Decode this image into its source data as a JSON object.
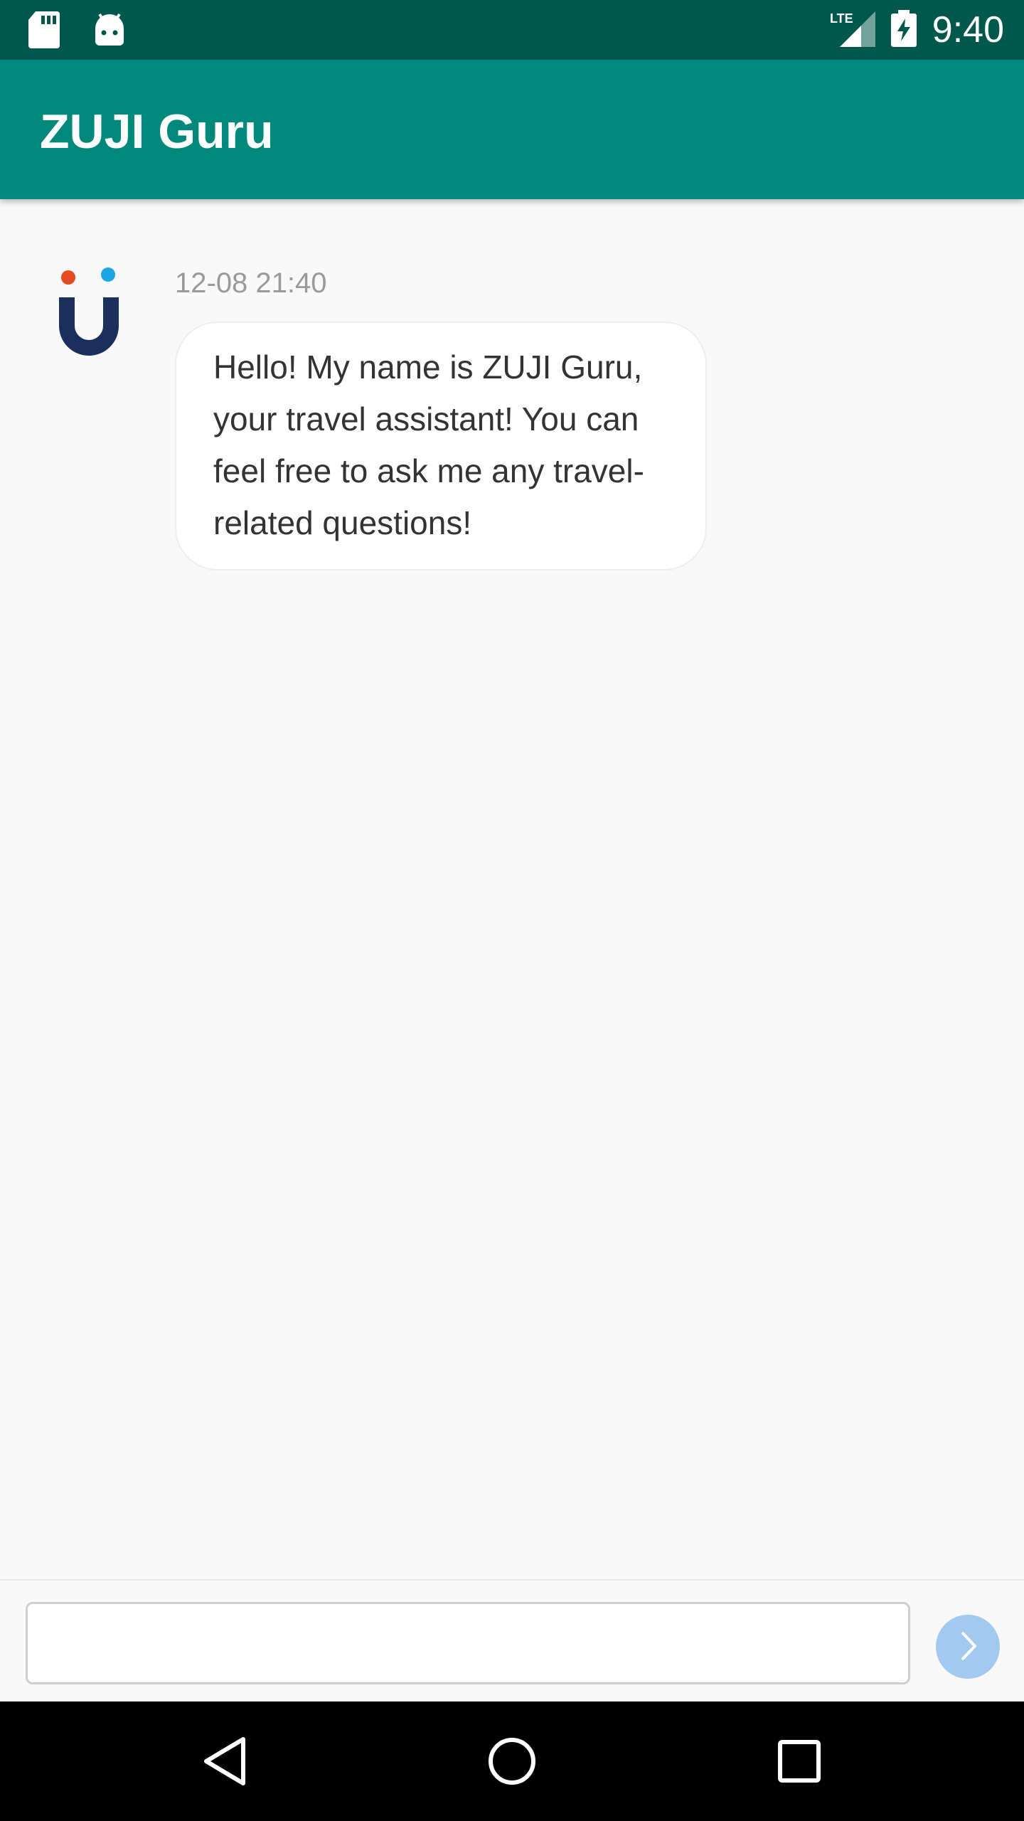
{
  "status_bar": {
    "time": "9:40",
    "network": "LTE",
    "icons": [
      "sd-card-icon",
      "android-icon",
      "signal-icon",
      "battery-charging-icon"
    ]
  },
  "app_bar": {
    "title": "ZUJI Guru",
    "background_color": "#00897b",
    "status_color": "#00574b"
  },
  "messages": [
    {
      "sender": "ZUJI Guru",
      "avatar_icon": "zuji-logo-icon",
      "timestamp": "12-08 21:40",
      "text": "Hello! My name is ZUJI Guru, your travel assistant! You can feel free to ask me any travel-related questions!"
    }
  ],
  "composer": {
    "value": "",
    "placeholder": "",
    "send_icon": "chevron-right-icon",
    "send_color": "#a3c9f1"
  },
  "nav_bar": {
    "buttons": [
      "back-icon",
      "home-icon",
      "recents-icon"
    ]
  }
}
